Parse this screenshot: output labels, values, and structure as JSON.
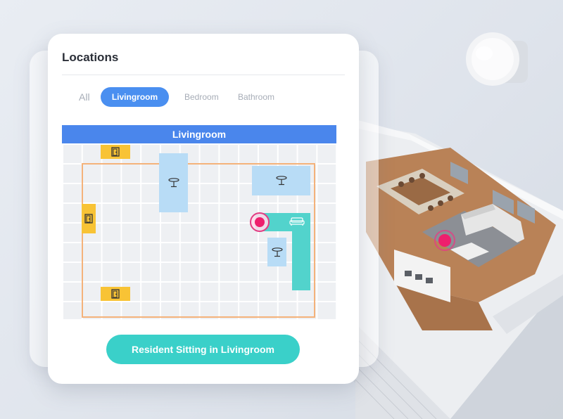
{
  "card": {
    "title": "Locations"
  },
  "tabs": [
    {
      "label": "All",
      "active": false
    },
    {
      "label": "Livingroom",
      "active": true
    },
    {
      "label": "Bedroom",
      "active": false
    },
    {
      "label": "Bathroom",
      "active": false
    }
  ],
  "floorplan": {
    "room_name": "Livingroom",
    "furniture": [
      {
        "type": "door",
        "icon": "door-icon"
      },
      {
        "type": "door",
        "icon": "door-icon"
      },
      {
        "type": "door",
        "icon": "door-icon"
      },
      {
        "type": "table",
        "icon": "table-icon"
      },
      {
        "type": "table",
        "icon": "table-icon"
      },
      {
        "type": "table",
        "icon": "table-icon"
      },
      {
        "type": "sofa",
        "icon": "sofa-icon"
      }
    ],
    "resident_marker": "location-pin-icon"
  },
  "status": {
    "label": "Resident Sitting in Livingroom"
  },
  "colors": {
    "accent_blue": "#4a8ff0",
    "header_blue": "#4a86ec",
    "teal": "#3ad0c9",
    "door_yellow": "#f8c335",
    "furniture_blue": "#b8dcf6",
    "resident_pink": "#ee1f6d",
    "room_border": "#f4b27a"
  }
}
